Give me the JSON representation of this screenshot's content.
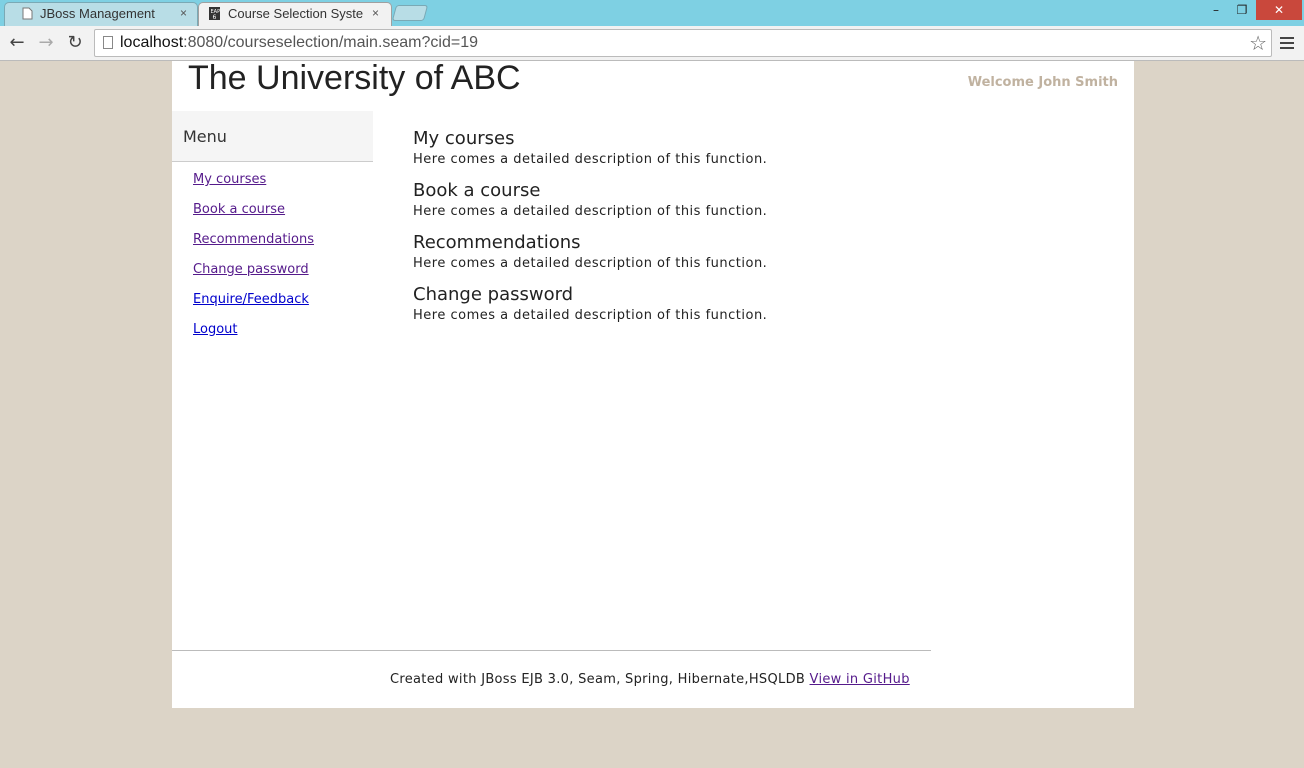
{
  "browser": {
    "tabs": [
      {
        "title": "JBoss Management",
        "close": "×",
        "active": false
      },
      {
        "title": "Course Selection Syster",
        "close": "×",
        "active": true
      }
    ],
    "window_controls": {
      "minimize": "–",
      "restore": "❐",
      "close": "✕"
    },
    "nav": {
      "back": "←",
      "forward": "→",
      "reload": "↻"
    },
    "url_host": "localhost",
    "url_rest": ":8080/courseselection/main.seam?cid=19",
    "bookmark_icon": "☆"
  },
  "header": {
    "site_title": "The University of ABC",
    "welcome": "Welcome John Smith"
  },
  "sidebar": {
    "heading": "Menu",
    "items": [
      {
        "label": "My courses",
        "visited": true
      },
      {
        "label": "Book a course",
        "visited": true
      },
      {
        "label": "Recommendations",
        "visited": true
      },
      {
        "label": "Change password",
        "visited": true
      },
      {
        "label": "Enquire/Feedback",
        "visited": false
      },
      {
        "label": "Logout",
        "visited": false
      }
    ]
  },
  "main": {
    "features": [
      {
        "title": "My courses",
        "description": "Here comes a detailed description of this function."
      },
      {
        "title": "Book a course",
        "description": "Here comes a detailed description of this function."
      },
      {
        "title": "Recommendations",
        "description": "Here comes a detailed description of this function."
      },
      {
        "title": "Change password",
        "description": "Here comes a detailed description of this function."
      }
    ]
  },
  "footer": {
    "text": "Created with JBoss EJB 3.0, Seam, Spring, Hibernate,HSQLDB ",
    "link": "View in GitHub"
  },
  "colors": {
    "background": "#dcd4c7",
    "tabbar": "#7ed0e3",
    "welcome": "#c0b2a0",
    "visited_link": "#551a8b",
    "link": "#0000cc"
  }
}
